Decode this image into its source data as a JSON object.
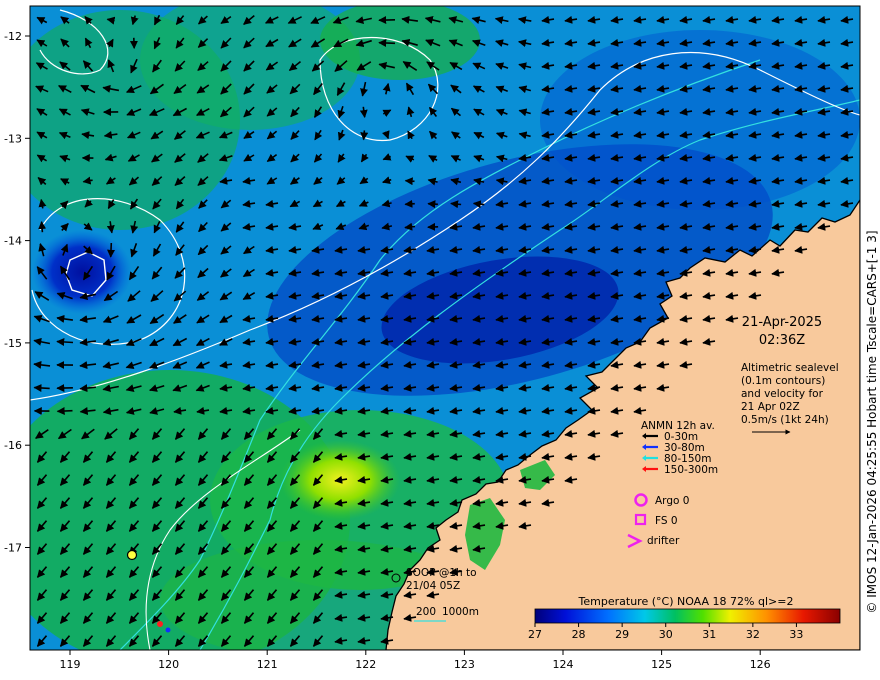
{
  "map": {
    "colors": {
      "land": "#f8c99c",
      "coast": "#000000",
      "contour": "#ffffff",
      "isobath": "#33e0e0",
      "arrow": "#000000",
      "argo": "#ee22ee"
    },
    "longitude_ticks": [
      "119",
      "120",
      "121",
      "122",
      "123",
      "124",
      "125",
      "126"
    ],
    "latitude_ticks": [
      "-12",
      "-13",
      "-14",
      "-15",
      "-16",
      "-17"
    ],
    "datetime": {
      "date": "21-Apr-2025",
      "time": "02:36Z"
    },
    "altimetry_note": {
      "line1": "Altimetric sealevel",
      "line2": "(0.1m contours)",
      "line3": "and velocity for",
      "line4": "21 Apr 02Z",
      "line5": "0.5m/s (1kt 24h)"
    },
    "anmn_legend": {
      "title": "ANMN 12h av.",
      "items": [
        {
          "label": "0-30m",
          "color": "#000000"
        },
        {
          "label": "30-80m",
          "color": "#1030ff"
        },
        {
          "label": "80-150m",
          "color": "#20e0e0"
        },
        {
          "label": "150-300m",
          "color": "#ff1010"
        }
      ]
    },
    "platforms": {
      "argo": "Argo 0",
      "fs": "FS 0",
      "drifter": "drifter"
    },
    "soop": {
      "line1": "SOOP @1h to",
      "line2": "21/04 05Z"
    },
    "isobaths": {
      "label1": "200",
      "label2": "1000m"
    },
    "colorbar": {
      "title": "Temperature (°C) NOAA 18 72% ql>=2",
      "ticks": [
        "27",
        "28",
        "29",
        "30",
        "31",
        "32",
        "33"
      ],
      "min": 27,
      "max": 34
    },
    "side_label": "© IMOS 12-Jan-2026 04:25:55 Hobart time Tscale=CARS+[-1 3]"
  }
}
